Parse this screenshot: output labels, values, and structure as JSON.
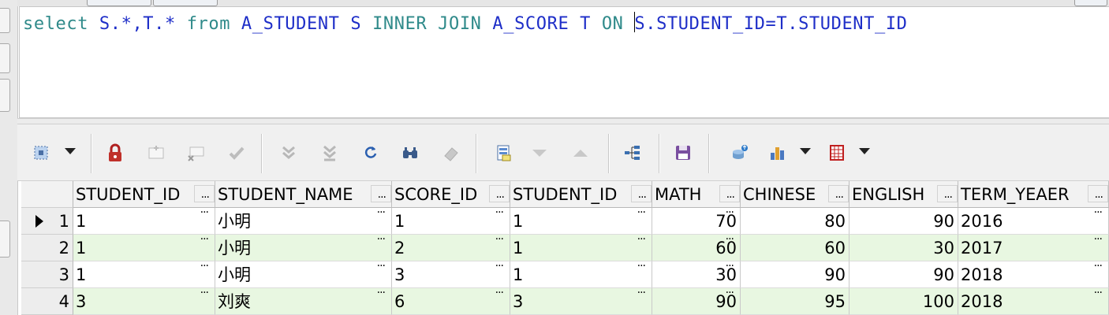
{
  "editor": {
    "sql_parts": [
      {
        "text": "select",
        "kind": "kw"
      },
      {
        "text": " S.*,T.* ",
        "kind": "tx"
      },
      {
        "text": "from",
        "kind": "kw"
      },
      {
        "text": " A_STUDENT S ",
        "kind": "tx"
      },
      {
        "text": "INNER JOIN",
        "kind": "kw"
      },
      {
        "text": " A_SCORE T ",
        "kind": "tx"
      },
      {
        "text": "ON",
        "kind": "kw"
      },
      {
        "text": " ",
        "kind": "tx"
      },
      {
        "text": "S.STUDENT_ID=T.STUDENT_ID",
        "kind": "tx"
      }
    ]
  },
  "colors": {
    "keyword": "#2f8a8a",
    "identifier": "#1e2ec8",
    "alt_row": "#e8f7e1",
    "row": "#ffffff"
  },
  "toolbar": {
    "icons": [
      "select-mode-icon",
      "lock-icon",
      "insert-record-icon",
      "delete-record-icon",
      "post-edits-icon",
      "first-record-icon",
      "last-record-icon",
      "refresh-icon",
      "find-icon",
      "clear-icon",
      "query-by-example-icon",
      "next-record-icon",
      "previous-record-icon",
      "tree-view-icon",
      "save-icon",
      "export-icon",
      "chart-icon",
      "grid-options-icon"
    ]
  },
  "grid": {
    "columns": [
      "STUDENT_ID",
      "STUDENT_NAME",
      "SCORE_ID",
      "STUDENT_ID",
      "MATH",
      "CHINESE",
      "ENGLISH",
      "TERM_YEAER"
    ],
    "rows": [
      {
        "index": "1",
        "cells": [
          "1",
          "小明",
          "1",
          "1",
          "70",
          "80",
          "90",
          "2016"
        ]
      },
      {
        "index": "2",
        "cells": [
          "1",
          "小明",
          "2",
          "1",
          "60",
          "60",
          "30",
          "2017"
        ]
      },
      {
        "index": "3",
        "cells": [
          "1",
          "小明",
          "3",
          "1",
          "30",
          "90",
          "90",
          "2018"
        ]
      },
      {
        "index": "4",
        "cells": [
          "3",
          "刘爽",
          "6",
          "3",
          "90",
          "95",
          "100",
          "2018"
        ]
      }
    ],
    "ellipsis": "..."
  }
}
